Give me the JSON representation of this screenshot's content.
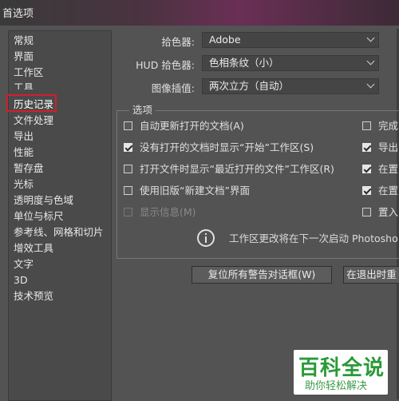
{
  "window": {
    "title": "首选项"
  },
  "sidebar": {
    "items": [
      {
        "label": "常规"
      },
      {
        "label": "界面"
      },
      {
        "label": "工作区"
      },
      {
        "label": "工具"
      },
      {
        "label": "历史记录"
      },
      {
        "label": "文件处理"
      },
      {
        "label": "导出"
      },
      {
        "label": "性能"
      },
      {
        "label": "暂存盘"
      },
      {
        "label": "光标"
      },
      {
        "label": "透明度与色域"
      },
      {
        "label": "单位与标尺"
      },
      {
        "label": "参考线、网格和切片"
      },
      {
        "label": "增效工具"
      },
      {
        "label": "文字"
      },
      {
        "label": "3D"
      },
      {
        "label": "技术预览"
      }
    ]
  },
  "general": {
    "color_picker": {
      "label": "拾色器:",
      "value": "Adobe"
    },
    "hud_color_picker": {
      "label": "HUD 拾色器:",
      "value": "色相条纹（小）"
    },
    "image_interpolation": {
      "label": "图像插值:",
      "value": "两次立方（自动）"
    }
  },
  "options": {
    "title": "选项",
    "left": [
      {
        "label": "自动更新打开的文档(A)",
        "checked": false,
        "disabled": false
      },
      {
        "label": "没有打开的文档时显示“开始”工作区(S)",
        "checked": true,
        "disabled": false
      },
      {
        "label": "打开文件时显示“最近打开的文件”工作区(R)",
        "checked": false,
        "disabled": false
      },
      {
        "label": "使用旧版“新建文档”界面",
        "checked": false,
        "disabled": false
      },
      {
        "label": "显示信息(M)",
        "checked": false,
        "disabled": true
      }
    ],
    "right": [
      {
        "label": "完成",
        "checked": false
      },
      {
        "label": "导出",
        "checked": true
      },
      {
        "label": "在置",
        "checked": true
      },
      {
        "label": "在置",
        "checked": true
      },
      {
        "label": "置入",
        "checked": false
      }
    ],
    "info_text": "工作区更改将在下一次启动 Photosho"
  },
  "buttons": {
    "reset_warnings": "复位所有警告对话框(W)",
    "reset_on_exit": "在退出时重"
  },
  "watermark": {
    "main": "百科全说",
    "sub": "助你轻松解决"
  }
}
